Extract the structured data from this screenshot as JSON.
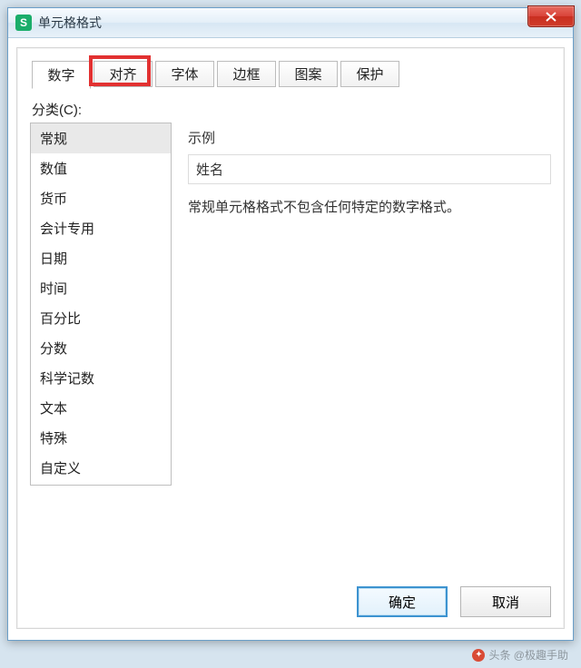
{
  "titlebar": {
    "title": "单元格格式"
  },
  "tabs": [
    {
      "label": "数字"
    },
    {
      "label": "对齐"
    },
    {
      "label": "字体"
    },
    {
      "label": "边框"
    },
    {
      "label": "图案"
    },
    {
      "label": "保护"
    }
  ],
  "category_label": "分类(C):",
  "categories": [
    "常规",
    "数值",
    "货币",
    "会计专用",
    "日期",
    "时间",
    "百分比",
    "分数",
    "科学记数",
    "文本",
    "特殊",
    "自定义"
  ],
  "selected_category_index": 0,
  "example": {
    "label": "示例",
    "value": "姓名"
  },
  "description": "常规单元格格式不包含任何特定的数字格式。",
  "buttons": {
    "ok": "确定",
    "cancel": "取消"
  },
  "watermark": "头条 @极趣手助",
  "highlight_tab_index": 1
}
